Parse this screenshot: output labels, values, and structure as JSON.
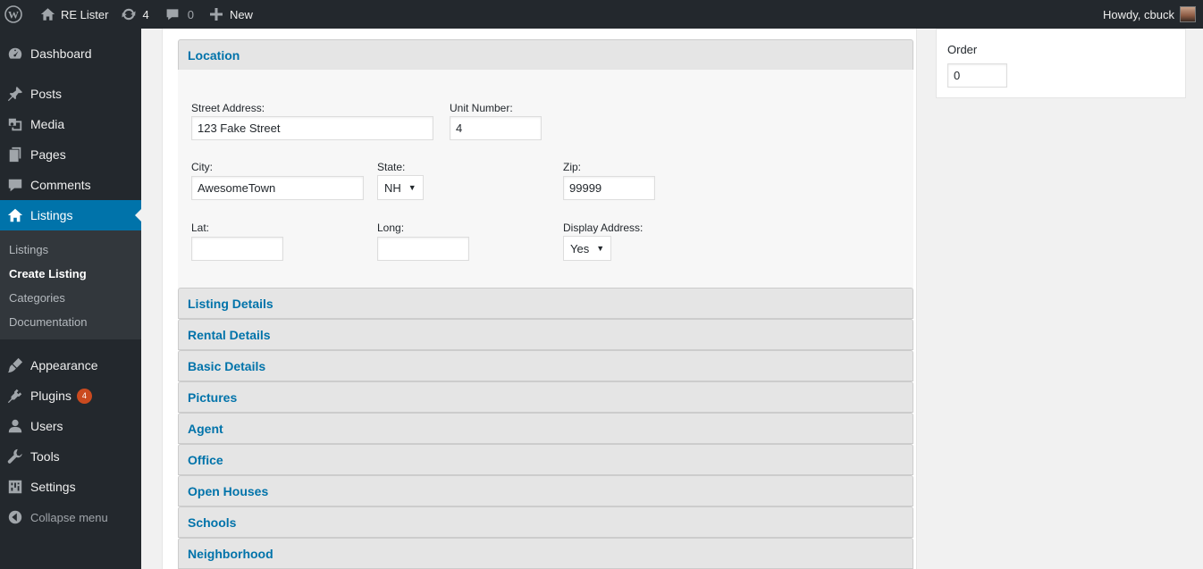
{
  "admin_bar": {
    "site_name": "RE Lister",
    "updates_count": "4",
    "comments_count": "0",
    "new_label": "New",
    "greeting": "Howdy, cbuck"
  },
  "sidebar": {
    "items": [
      {
        "label": "Dashboard",
        "icon": "dashboard-icon"
      },
      {
        "label": "Posts",
        "icon": "pin-icon"
      },
      {
        "label": "Media",
        "icon": "media-icon"
      },
      {
        "label": "Pages",
        "icon": "pages-icon"
      },
      {
        "label": "Comments",
        "icon": "comment-icon"
      },
      {
        "label": "Listings",
        "icon": "home-icon"
      },
      {
        "label": "Appearance",
        "icon": "brush-icon"
      },
      {
        "label": "Plugins",
        "icon": "plug-icon",
        "badge": "4"
      },
      {
        "label": "Users",
        "icon": "user-icon"
      },
      {
        "label": "Tools",
        "icon": "wrench-icon"
      },
      {
        "label": "Settings",
        "icon": "settings-icon"
      }
    ],
    "submenu": [
      "Listings",
      "Create Listing",
      "Categories",
      "Documentation"
    ],
    "collapse_label": "Collapse menu"
  },
  "location": {
    "title": "Location",
    "street_label": "Street Address:",
    "street_value": "123 Fake Street",
    "unit_label": "Unit Number:",
    "unit_value": "4",
    "city_label": "City:",
    "city_value": "AwesomeTown",
    "state_label": "State:",
    "state_value": "NH",
    "zip_label": "Zip:",
    "zip_value": "99999",
    "lat_label": "Lat:",
    "lat_value": "",
    "long_label": "Long:",
    "long_value": "",
    "display_label": "Display Address:",
    "display_value": "Yes"
  },
  "sections": [
    "Listing Details",
    "Rental Details",
    "Basic Details",
    "Pictures",
    "Agent",
    "Office",
    "Open Houses",
    "Schools",
    "Neighborhood"
  ],
  "order_box": {
    "label": "Order",
    "value": "0"
  },
  "colors": {
    "accent": "#0073aa",
    "admin_bg": "#23282d",
    "badge": "#ca4a1f"
  }
}
